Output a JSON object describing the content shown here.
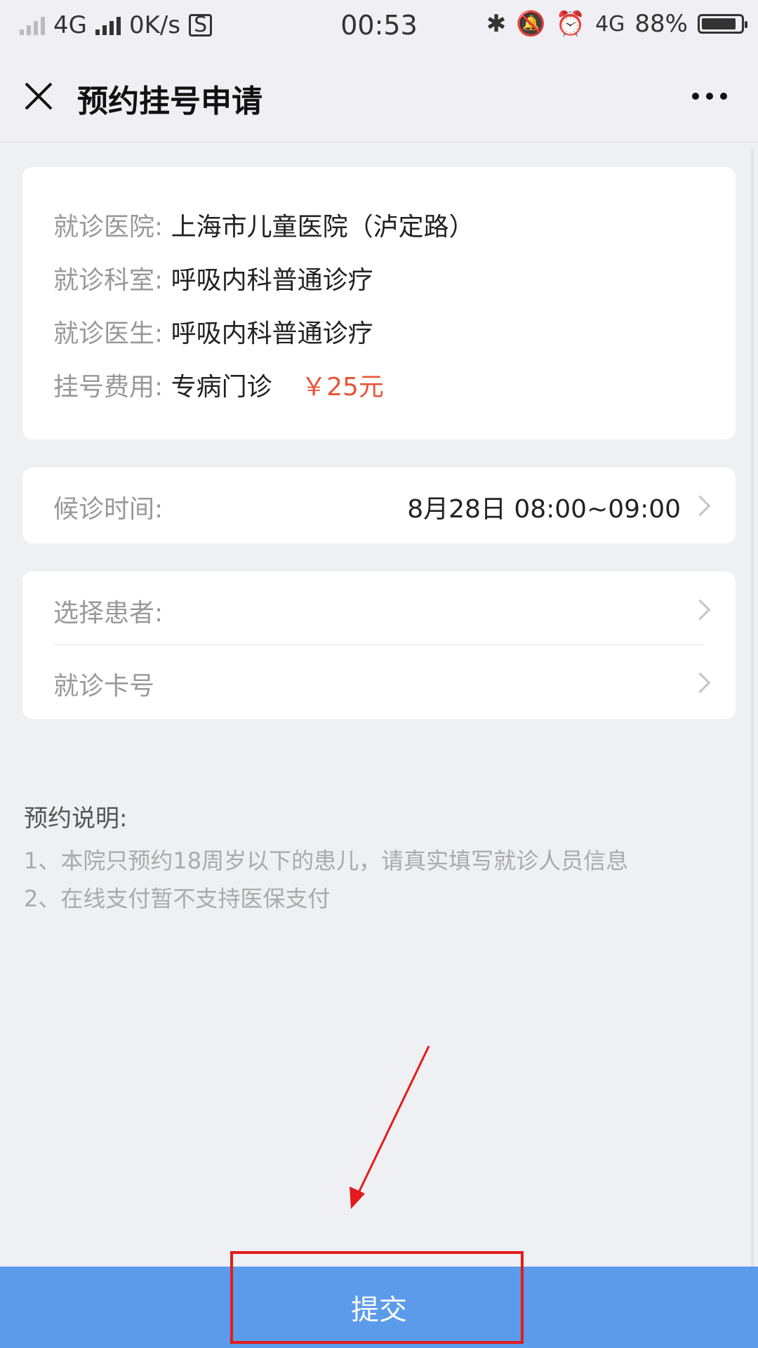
{
  "status_bar": {
    "network": "4G",
    "speed": "0K/s",
    "time": "00:53",
    "network2": "4G",
    "battery": "88%"
  },
  "header": {
    "title": "预约挂号申请"
  },
  "info": {
    "hospital_label": "就诊医院:",
    "hospital_value": "上海市儿童医院（泸定路）",
    "department_label": "就诊科室:",
    "department_value": "呼吸内科普通诊疗",
    "doctor_label": "就诊医生:",
    "doctor_value": "呼吸内科普通诊疗",
    "fee_label": "挂号费用:",
    "fee_type": "专病门诊",
    "fee_amount": "￥25元"
  },
  "wait_time": {
    "label": "候诊时间:",
    "value": "8月28日 08:00~09:00"
  },
  "patient": {
    "select_label": "选择患者:",
    "card_label": "就诊卡号"
  },
  "notes": {
    "title": "预约说明:",
    "items": [
      "1、本院只预约18周岁以下的患儿，请真实填写就诊人员信息",
      "2、在线支付暂不支持医保支付"
    ]
  },
  "submit_label": "提交",
  "colors": {
    "accent": "#5b9bea",
    "price": "#e8553a",
    "annotation": "#e31b1b"
  }
}
